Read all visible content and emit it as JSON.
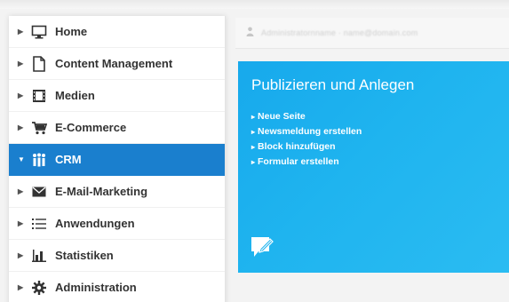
{
  "sidebar": {
    "items": [
      {
        "label": "Home",
        "icon": "monitor-icon",
        "caret": "▶",
        "active": false
      },
      {
        "label": "Content Management",
        "icon": "document-icon",
        "caret": "▶",
        "active": false
      },
      {
        "label": "Medien",
        "icon": "film-icon",
        "caret": "▶",
        "active": false
      },
      {
        "label": "E-Commerce",
        "icon": "cart-icon",
        "caret": "▶",
        "active": false
      },
      {
        "label": "CRM",
        "icon": "people-icon",
        "caret": "▼",
        "active": true
      },
      {
        "label": "E-Mail-Marketing",
        "icon": "envelope-icon",
        "caret": "▶",
        "active": false
      },
      {
        "label": "Anwendungen",
        "icon": "list-icon",
        "caret": "▶",
        "active": false
      },
      {
        "label": "Statistiken",
        "icon": "bar-chart-icon",
        "caret": "▶",
        "active": false
      },
      {
        "label": "Administration",
        "icon": "gear-icon",
        "caret": "▶",
        "active": false
      }
    ]
  },
  "header": {
    "user_icon": "user-icon",
    "user_text": "Administratornname · name@domain.com"
  },
  "panel": {
    "title": "Publizieren und Anlegen",
    "links": [
      {
        "label": "Neue Seite",
        "bullet": "▸"
      },
      {
        "label": "Newsmeldung erstellen",
        "bullet": "▸"
      },
      {
        "label": "Block hinzufügen",
        "bullet": "▸"
      },
      {
        "label": "Formular erstellen",
        "bullet": "▸"
      }
    ],
    "icon": "edit-note-icon"
  },
  "colors": {
    "active_bg": "#1a7fce",
    "panel_bg": "#1fb4ef",
    "text": "#333333"
  }
}
